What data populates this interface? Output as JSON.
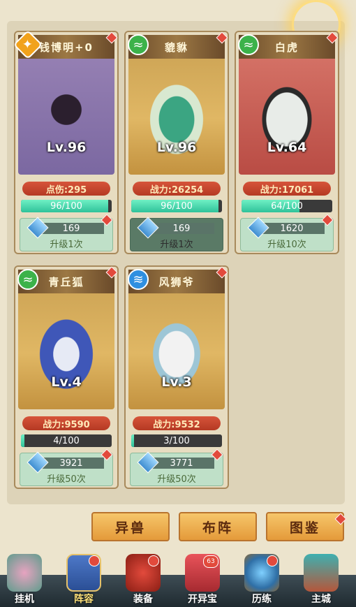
{
  "cards": [
    {
      "name": "钱博明+0",
      "element": "star",
      "level": "Lv.96",
      "power": "点伤:295",
      "progress_text": "96/100",
      "progress": 0.96,
      "count": "169",
      "upgrade": "升级1次",
      "art": "purple",
      "upgrade_dim": false
    },
    {
      "name": "貔貅",
      "element": "green",
      "level": "Lv.96",
      "power": "战力:26254",
      "progress_text": "96/100",
      "progress": 0.96,
      "count": "169",
      "upgrade": "升级1次",
      "art": "gold",
      "upgrade_dim": true
    },
    {
      "name": "白虎",
      "element": "green",
      "level": "Lv.64",
      "power": "战力:17061",
      "progress_text": "64/100",
      "progress": 0.64,
      "count": "1620",
      "upgrade": "升级10次",
      "art": "red",
      "upgrade_dim": false
    },
    {
      "name": "青丘狐",
      "element": "green",
      "level": "Lv.4",
      "power": "战力:9590",
      "progress_text": "4/100",
      "progress": 0.04,
      "count": "3921",
      "upgrade": "升级50次",
      "art": "gold",
      "upgrade_dim": false
    },
    {
      "name": "风狮爷",
      "element": "blue",
      "level": "Lv.3",
      "power": "战力:9532",
      "progress_text": "3/100",
      "progress": 0.03,
      "count": "3771",
      "upgrade": "升级50次",
      "art": "gold",
      "upgrade_dim": false
    }
  ],
  "buttons": {
    "beasts": "异兽",
    "formation": "布阵",
    "codex": "图鉴"
  },
  "nav": [
    {
      "label": "挂机",
      "icon": "sword-tree-icon"
    },
    {
      "label": "阵容",
      "icon": "shield-icon"
    },
    {
      "label": "装备",
      "icon": "helmet-icon"
    },
    {
      "label": "开异宝",
      "icon": "treasure-chest-icon",
      "badge": "63"
    },
    {
      "label": "历练",
      "icon": "portal-icon"
    },
    {
      "label": "主城",
      "icon": "gate-icon"
    }
  ]
}
